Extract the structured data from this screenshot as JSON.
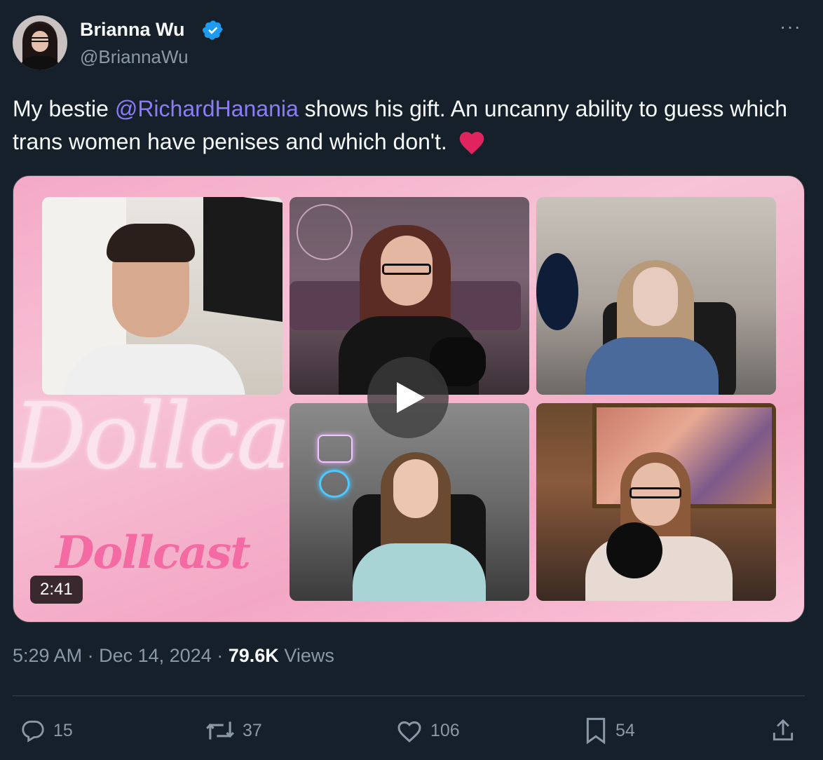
{
  "author": {
    "display_name": "Brianna Wu",
    "handle": "@BriannaWu",
    "verified": true
  },
  "tweet": {
    "text_before": "My bestie ",
    "mention": "@RichardHanania",
    "text_after": " shows his gift. An uncanny ability to guess which trans women have penises and which don't.",
    "emoji": "red-heart"
  },
  "media": {
    "type": "video",
    "duration": "2:41",
    "logo_large": "Dollcast",
    "logo_small": "Dollcast"
  },
  "meta": {
    "time": "5:29 AM",
    "separator": "·",
    "date": "Dec 14, 2024",
    "views_count": "79.6K",
    "views_label": "Views"
  },
  "actions": {
    "replies": "15",
    "retweets": "37",
    "likes": "106",
    "bookmarks": "54"
  },
  "colors": {
    "background": "#15202b",
    "mention": "#8d7cf7",
    "verified": "#1d9bf0",
    "heart": "#e0245e",
    "muted": "#8b98a5"
  },
  "icons": [
    "verified-badge-icon",
    "more-options-icon",
    "play-icon",
    "reply-icon",
    "retweet-icon",
    "like-icon",
    "bookmark-icon",
    "share-icon"
  ]
}
